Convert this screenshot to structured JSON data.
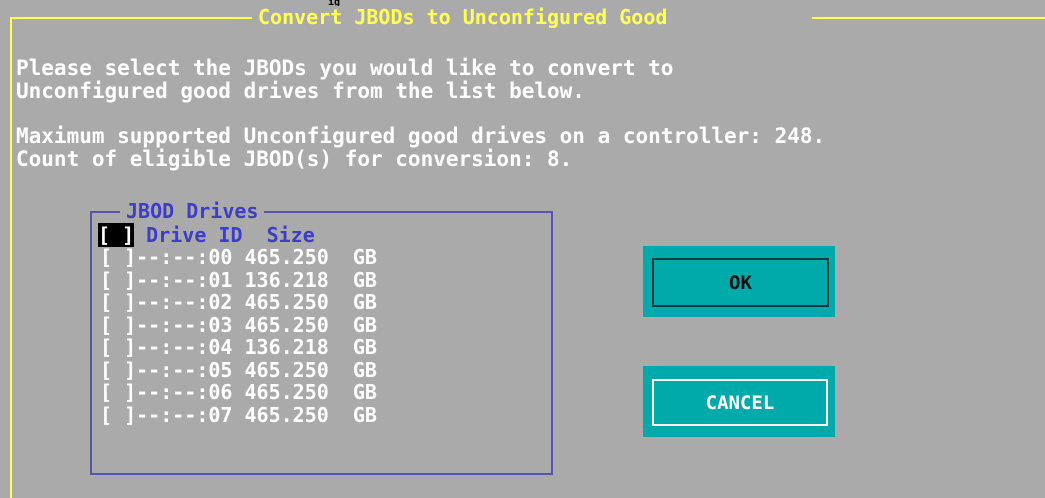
{
  "dialog": {
    "title": "Convert JBODs to Unconfigured Good",
    "cropped_top_text": "ig",
    "instructions_line1": "Please select the JBODs you would like to convert to",
    "instructions_line2": "Unconfigured good drives from the list below.",
    "max_supported_line": "Maximum supported Unconfigured good drives on a controller: 248.",
    "eligible_count_line": "Count of eligible JBOD(s) for conversion: 8."
  },
  "jbod_list": {
    "title": "JBOD Drives",
    "select_all_checkbox": "[ ]",
    "columns": [
      "Drive ID",
      "Size"
    ],
    "drives": [
      {
        "checkbox": "[ ]",
        "drive_id": "--:--:00",
        "size": "465.250",
        "unit": "GB"
      },
      {
        "checkbox": "[ ]",
        "drive_id": "--:--:01",
        "size": "136.218",
        "unit": "GB"
      },
      {
        "checkbox": "[ ]",
        "drive_id": "--:--:02",
        "size": "465.250",
        "unit": "GB"
      },
      {
        "checkbox": "[ ]",
        "drive_id": "--:--:03",
        "size": "465.250",
        "unit": "GB"
      },
      {
        "checkbox": "[ ]",
        "drive_id": "--:--:04",
        "size": "136.218",
        "unit": "GB"
      },
      {
        "checkbox": "[ ]",
        "drive_id": "--:--:05",
        "size": "465.250",
        "unit": "GB"
      },
      {
        "checkbox": "[ ]",
        "drive_id": "--:--:06",
        "size": "465.250",
        "unit": "GB"
      },
      {
        "checkbox": "[ ]",
        "drive_id": "--:--:07",
        "size": "465.250",
        "unit": "GB"
      }
    ]
  },
  "buttons": {
    "ok_label": "OK",
    "cancel_label": "CANCEL"
  },
  "colors": {
    "background": "#aaaaaa",
    "title_yellow": "#ffff55",
    "groupbox_blue": "#3d3dc8",
    "button_teal": "#00aaaa",
    "text_white": "#ffffff"
  }
}
